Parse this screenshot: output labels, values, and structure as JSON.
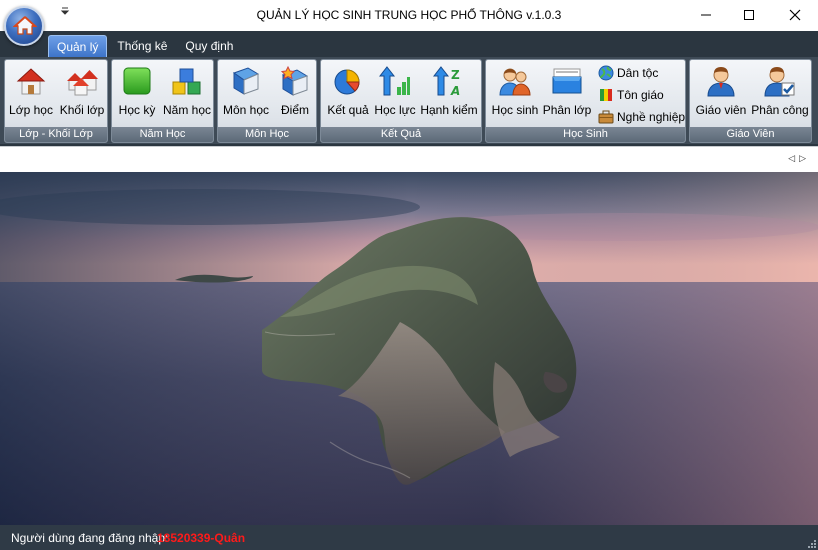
{
  "window": {
    "title": "QUẢN LÝ HỌC SINH TRUNG HỌC PHỔ THÔNG v.1.0.3",
    "qat_icon": "dropdown-arrow-icon",
    "controls": [
      "minimize-icon",
      "maximize-icon",
      "close-icon"
    ]
  },
  "ribbon": {
    "tabs": [
      {
        "label": "Quản lý",
        "active": true
      },
      {
        "label": "Thống kê",
        "active": false
      },
      {
        "label": "Quy định",
        "active": false
      }
    ],
    "groups": [
      {
        "label": "Lớp - Khối Lớp",
        "buttons": [
          {
            "label": "Lớp học",
            "icon": "house-icon"
          },
          {
            "label": "Khối lớp",
            "icon": "houses-icon"
          }
        ]
      },
      {
        "label": "Năm Học",
        "buttons": [
          {
            "label": "Học kỳ",
            "icon": "green-square-icon"
          },
          {
            "label": "Năm học",
            "icon": "cubes-icon"
          }
        ]
      },
      {
        "label": "Môn Học",
        "buttons": [
          {
            "label": "Môn học",
            "icon": "book-icon"
          },
          {
            "label": "Điểm",
            "icon": "star-book-icon"
          }
        ]
      },
      {
        "label": "Kết Quả",
        "buttons": [
          {
            "label": "Kết quả",
            "icon": "pie-chart-icon"
          },
          {
            "label": "Học lực",
            "icon": "up-arrow-bars-icon"
          },
          {
            "label": "Hạnh kiểm",
            "icon": "sort-az-icon"
          }
        ]
      },
      {
        "label": "Học Sinh",
        "buttons": [
          {
            "label": "Học sinh",
            "icon": "users-icon"
          },
          {
            "label": "Phân lớp",
            "icon": "folder-icon"
          }
        ],
        "small_buttons": [
          {
            "label": "Dân tộc",
            "icon": "globe-icon"
          },
          {
            "label": "Tôn giáo",
            "icon": "flag-icon"
          },
          {
            "label": "Nghề nghiệp",
            "icon": "briefcase-icon"
          }
        ]
      },
      {
        "label": "Giáo Viên",
        "buttons": [
          {
            "label": "Giáo viên",
            "icon": "teacher-icon"
          },
          {
            "label": "Phân công",
            "icon": "assign-teacher-icon"
          }
        ]
      }
    ]
  },
  "doc_nav_icons": [
    "scroll-left-icon",
    "scroll-right-icon"
  ],
  "status": {
    "label": "Người dùng đang đăng nhập:",
    "user": "18520339-Quân",
    "user_color": "#ff1a1a"
  },
  "colors": {
    "ribbon_bg": "#2b3640",
    "tab_active": "#3d74c9",
    "status_bg": "#2f3a46"
  }
}
